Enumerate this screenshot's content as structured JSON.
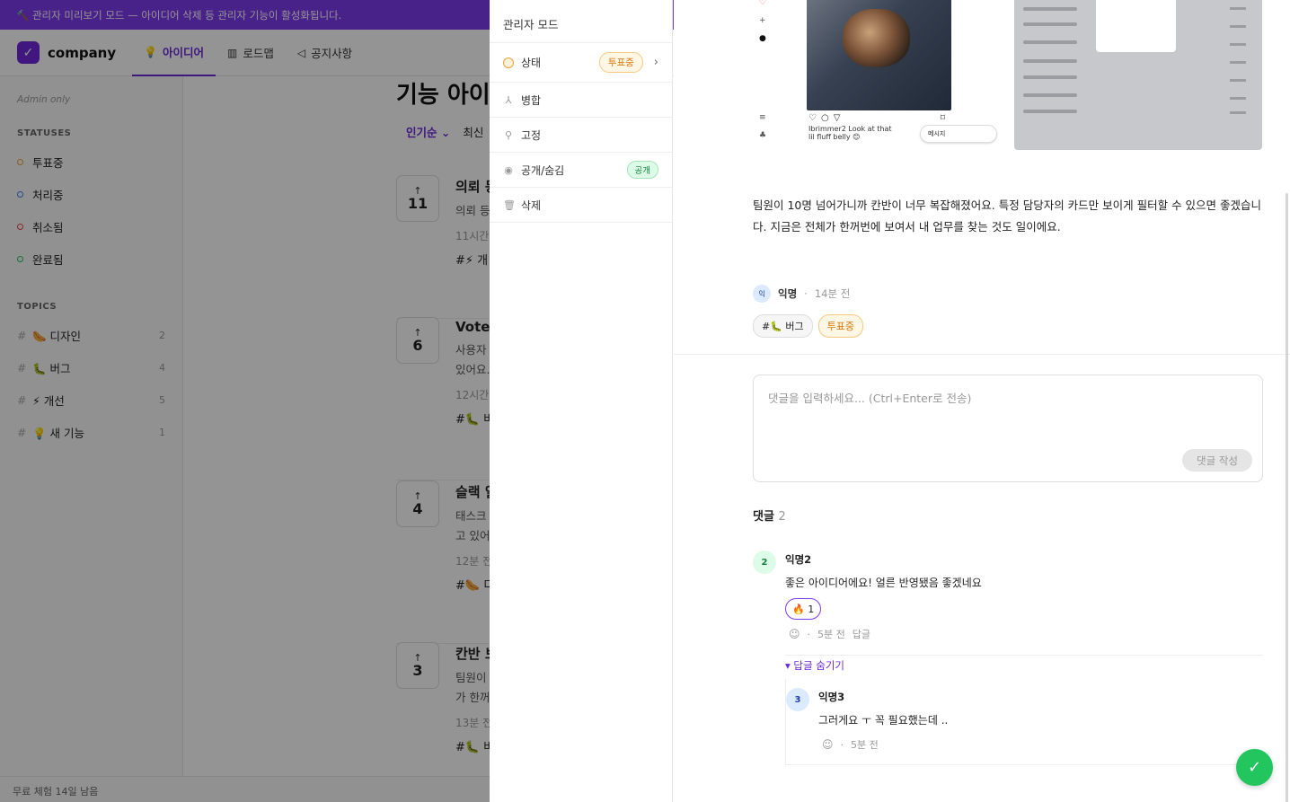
{
  "banner": {
    "text": "🔨 관리자 미리보기 모드 — 아이디어 삭제 등 관리자 기능이 활성화됩니다."
  },
  "brand": {
    "name": "company"
  },
  "nav": [
    {
      "label": "아이디어",
      "icon": "lightbulb-icon",
      "active": true
    },
    {
      "label": "로드맵",
      "icon": "map-icon",
      "active": false
    },
    {
      "label": "공지사항",
      "icon": "megaphone-icon",
      "active": false
    }
  ],
  "sidebar": {
    "admin_only": "Admin only",
    "statuses_title": "STATUSES",
    "statuses": [
      {
        "label": "투표중",
        "color": "#e9a23b"
      },
      {
        "label": "처리중",
        "color": "#3b82f6"
      },
      {
        "label": "취소됨",
        "color": "#ef4444"
      },
      {
        "label": "완료됨",
        "color": "#22c55e"
      }
    ],
    "topics_title": "TOPICS",
    "topics": [
      {
        "label": "🌭 디자인",
        "count": "2"
      },
      {
        "label": "🐛 버그",
        "count": "4"
      },
      {
        "label": "⚡ 개선",
        "count": "5"
      },
      {
        "label": "💡 새 기능",
        "count": "1"
      }
    ],
    "trial": "무료 체험 14일 남음"
  },
  "main": {
    "title": "기능 아이디어",
    "sort": [
      "인기순 ⌄",
      "최신"
    ],
    "cards": [
      {
        "votes": "11",
        "title": "의뢰 등",
        "desc": "의뢰 등",
        "time": "11시간",
        "tag": "#⚡ 개"
      },
      {
        "votes": "6",
        "title": "VoteB",
        "desc": "사용자\n있어요.",
        "time": "12시간",
        "tag": "#🐛 버"
      },
      {
        "votes": "4",
        "title": "슬랙 알",
        "desc": "태스크\n고 있어",
        "time": "12분 전",
        "tag": "#🌭 디"
      },
      {
        "votes": "3",
        "title": "칸반 보",
        "desc": "팀원이\n가 한꺼",
        "time": "13분 전",
        "tag": "#🐛 버"
      }
    ]
  },
  "admin": {
    "title": "관리자 모드",
    "status_label": "상태",
    "status_value": "투표중",
    "merge_label": "병합",
    "pin_label": "고정",
    "visibility_label": "공개/숨김",
    "visibility_value": "공개",
    "delete_label": "삭제"
  },
  "detail": {
    "body": "팀원이 10명 넘어가니까 칸반이 너무 복잡해졌어요. 특정 담당자의 카드만 보이게 필터할 수 있으면 좋겠습니다. 지금은 전체가 한꺼번에 보여서 내 업무를 찾는 것도 일이에요.",
    "author": {
      "avatar": "익",
      "name": "익명",
      "time": "14분 전"
    },
    "tags": [
      {
        "label": "#🐛 버그"
      },
      {
        "label": "투표중"
      }
    ],
    "comment_placeholder": "댓글을 입력하세요... (Ctrl+Enter로 전송)",
    "comment_submit": "댓글 작성",
    "comments_label": "댓글",
    "comments_count": "2",
    "comments": [
      {
        "avatar": "2",
        "name": "익명2",
        "text": "좋은 아이디어에요! 얼른 반영됐음 좋겠네요",
        "reaction": "🔥 1",
        "time": "5분 전",
        "reply": "답글"
      }
    ],
    "hide_replies": "▾ 답글 숨기기",
    "replies": [
      {
        "avatar": "3",
        "name": "익명3",
        "text": "그러게요 ㅜ 꼭 필요했는데 ..",
        "time": "5분 전"
      }
    ],
    "image_texts": {
      "caption": "Ibrimmer2 Look at that lil fluff belly 😊",
      "chat": "메시지"
    }
  },
  "fab": {
    "icon": "check-icon",
    "symbol": "✓"
  }
}
